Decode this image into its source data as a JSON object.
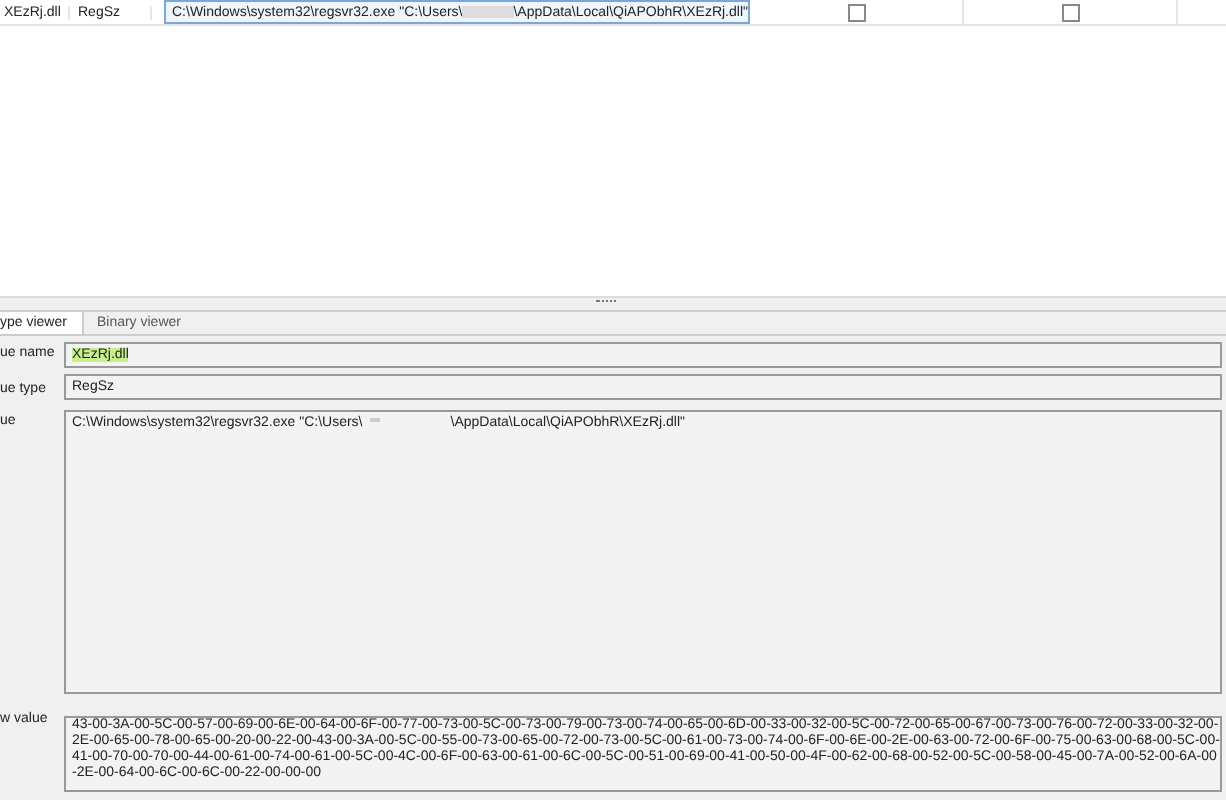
{
  "table": {
    "rows": [
      {
        "name": "XEzRj.dll",
        "type": "RegSz",
        "value_before": "C:\\Windows\\system32\\regsvr32.exe \"C:\\Users\\",
        "value_after": "\\AppData\\Local\\QiAPObhR\\XEzRj.dll\"",
        "selected": true,
        "checks": [
          {
            "checked": false
          },
          {
            "checked": false
          }
        ]
      }
    ]
  },
  "tabs": [
    {
      "label": "ype viewer",
      "selected": true
    },
    {
      "label": "Binary viewer",
      "selected": false
    }
  ],
  "fields": [
    {
      "label": "ue name",
      "kind": "name",
      "value": "XEzRj.dll"
    },
    {
      "label": "ue type",
      "kind": "line",
      "value": "RegSz"
    },
    {
      "label": "ue",
      "kind": "multi",
      "value_before": "C:\\Windows\\system32\\regsvr32.exe \"C:\\Users\\",
      "value_after": "\\AppData\\Local\\QiAPObhR\\XEzRj.dll\""
    },
    {
      "label": "w value",
      "kind": "hex",
      "value": "43-00-3A-00-5C-00-57-00-69-00-6E-00-64-00-6F-00-77-00-73-00-5C-00-73-00-79-00-73-00-74-00-65-00-6D-00-33-00-32-00-5C-00-72-00-65-00-67-00-73-00-76-00-72-00-33-00-32-00-2E-00-65-00-78-00-65-00-20-00-22-00-43-00-3A-00-5C-00-55-00-73-00-65-00-72-00-73-00-5C-00-61-00-73-00-74-00-6F-00-6E-00-2E-00-63-00-72-00-6F-00-75-00-63-00-68-00-5C-00-41-00-70-00-70-00-44-00-61-00-74-00-61-00-5C-00-4C-00-6F-00-63-00-61-00-6C-00-5C-00-51-00-69-00-41-00-50-00-4F-00-62-00-68-00-52-00-5C-00-58-00-45-00-7A-00-52-00-6A-00-2E-00-64-00-6C-00-6C-00-22-00-00-00"
    }
  ]
}
